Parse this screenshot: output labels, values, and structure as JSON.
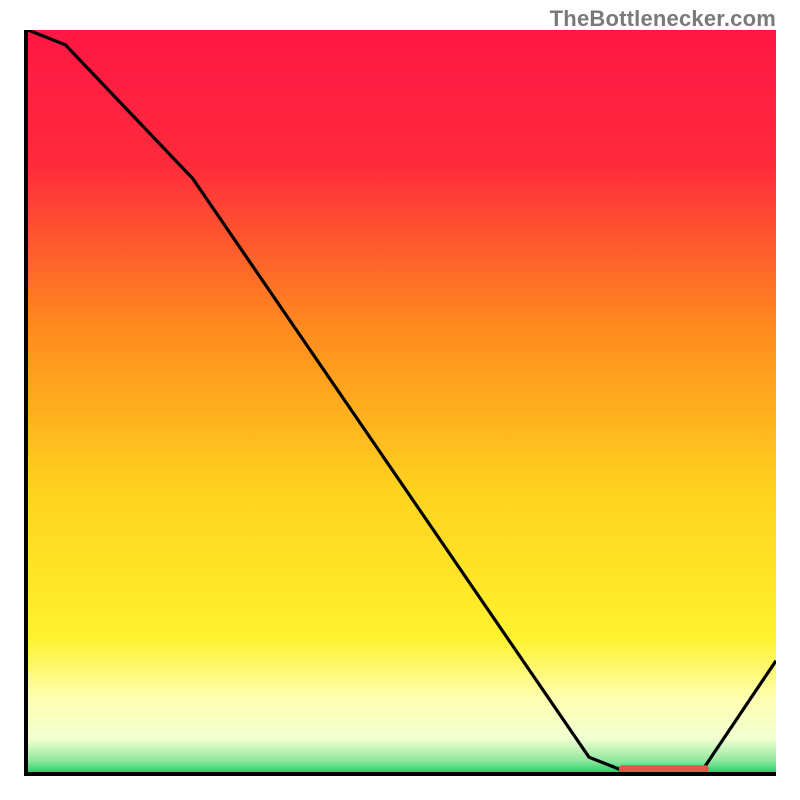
{
  "watermark": "TheBottleneсker.com",
  "chart_data": {
    "type": "line",
    "title": "",
    "xlabel": "",
    "ylabel": "",
    "xlim": [
      0,
      100
    ],
    "ylim": [
      0,
      100
    ],
    "x": [
      0,
      5,
      22,
      75,
      80,
      90,
      100
    ],
    "values": [
      100,
      98,
      80,
      2,
      0,
      0,
      15
    ],
    "gradient_stops": [
      {
        "offset": 0.0,
        "color": "#ff1744"
      },
      {
        "offset": 0.18,
        "color": "#ff2a3c"
      },
      {
        "offset": 0.4,
        "color": "#ff8a1e"
      },
      {
        "offset": 0.62,
        "color": "#ffd21e"
      },
      {
        "offset": 0.82,
        "color": "#fff22e"
      },
      {
        "offset": 0.9,
        "color": "#ffffb0"
      },
      {
        "offset": 0.955,
        "color": "#f2ffd0"
      },
      {
        "offset": 0.985,
        "color": "#8fe89f"
      },
      {
        "offset": 1.0,
        "color": "#27d06a"
      }
    ],
    "marker": {
      "x_start": 79,
      "x_end": 91,
      "y": 0.5,
      "color": "#e05a4a"
    }
  }
}
